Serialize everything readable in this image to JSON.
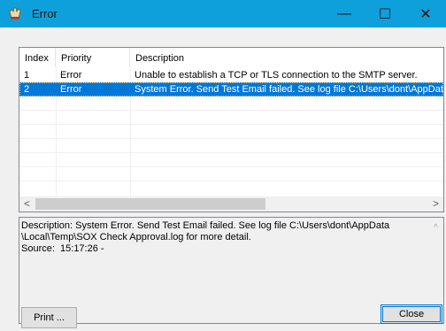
{
  "window": {
    "title": "Error",
    "icon": "error-app-icon",
    "controls": {
      "minimize": "—",
      "maximize": "☐",
      "close": "✕"
    }
  },
  "list": {
    "columns": [
      "Index",
      "Priority",
      "Description"
    ],
    "rows": [
      {
        "index": "1",
        "priority": "Error",
        "description": "Unable to establish a TCP or TLS connection to the SMTP server.",
        "selected": false
      },
      {
        "index": "2",
        "priority": "Error",
        "description": "System Error. Send Test Email failed. See log file C:\\Users\\dont\\AppData\\Local\\Temp\\SOX Check Approval.log for more detail.",
        "selected": true
      }
    ],
    "scroll_left_glyph": "<",
    "scroll_right_glyph": ">"
  },
  "detail": {
    "text": "Description: System Error. Send Test Email failed. See log file C:\\Users\\dont\\AppData\n\\Local\\Temp\\SOX Check Approval.log for more detail.\nSource:  15:17:26 -",
    "scroll_up_glyph": "^",
    "scroll_down_glyph": "v"
  },
  "buttons": {
    "print": "Print ...",
    "close": "Close"
  },
  "colors": {
    "titlebar": "#0ea0db",
    "selection": "#0078d7"
  }
}
